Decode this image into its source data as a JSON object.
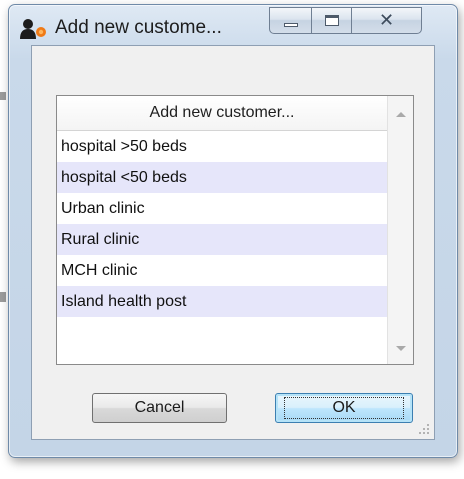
{
  "window": {
    "title": "Add new custome...",
    "close_glyph": "✕",
    "icon": "customer-add-icon"
  },
  "list": {
    "header": "Add new customer...",
    "rows": [
      "hospital >50 beds",
      "hospital <50 beds",
      "Urban clinic",
      "Rural clinic",
      "MCH clinic",
      "Island health post"
    ]
  },
  "buttons": {
    "cancel_label": "Cancel",
    "ok_label": "OK"
  },
  "colors": {
    "row_alt": "#e6e6fa",
    "ok_accent": "#3c7fb1"
  }
}
